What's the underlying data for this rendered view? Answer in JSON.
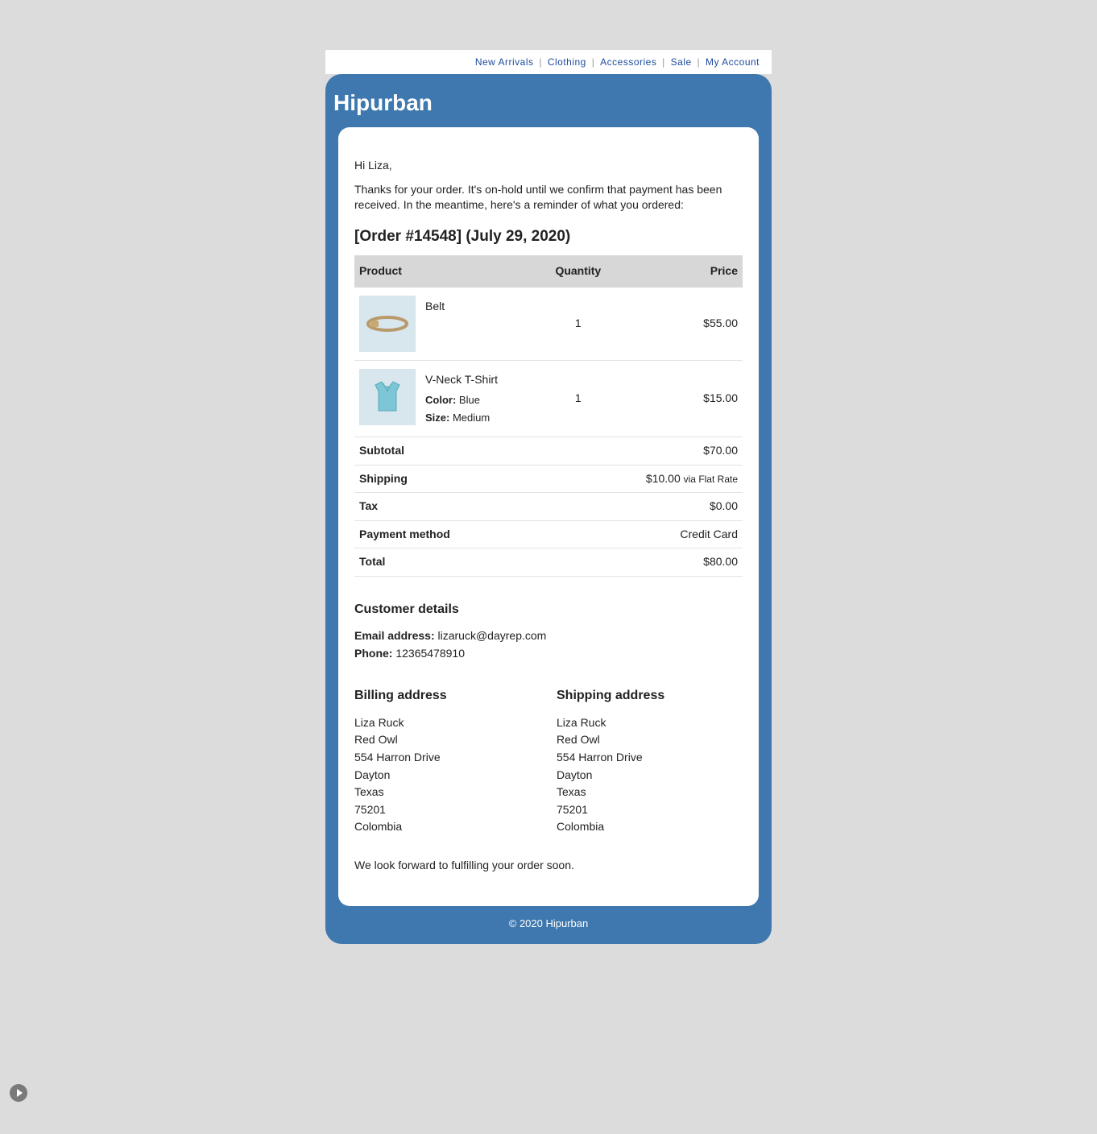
{
  "nav": [
    "New Arrivals",
    "Clothing",
    "Accessories",
    "Sale",
    "My Account"
  ],
  "brand": "Hipurban",
  "greeting": "Hi Liza,",
  "intro": "Thanks for your order. It's on-hold until we confirm that payment has been received. In the meantime, here's a reminder of what you ordered:",
  "order_title": "[Order #14548] (July 29, 2020)",
  "headers": {
    "product": "Product",
    "quantity": "Quantity",
    "price": "Price"
  },
  "items": [
    {
      "name": "Belt",
      "qty": "1",
      "price": "$55.00",
      "attrs": []
    },
    {
      "name": "V-Neck T-Shirt",
      "qty": "1",
      "price": "$15.00",
      "attrs": [
        {
          "label": "Color:",
          "value": "Blue"
        },
        {
          "label": "Size:",
          "value": "Medium"
        }
      ]
    }
  ],
  "summary": {
    "subtotal_label": "Subtotal",
    "subtotal": "$70.00",
    "shipping_label": "Shipping",
    "shipping": "$10.00",
    "shipping_via": "via Flat Rate",
    "tax_label": "Tax",
    "tax": "$0.00",
    "payment_label": "Payment method",
    "payment": "Credit Card",
    "total_label": "Total",
    "total": "$80.00"
  },
  "cust_header": "Customer details",
  "cust": {
    "email_label": "Email address:",
    "email": "lizaruck@dayrep.com",
    "phone_label": "Phone:",
    "phone": "12365478910"
  },
  "billing_header": "Billing address",
  "shipping_header": "Shipping address",
  "address_lines": [
    "Liza Ruck",
    "Red Owl",
    "554 Harron Drive",
    "Dayton",
    "Texas",
    "75201",
    "Colombia"
  ],
  "closing": "We look forward to fulfilling your order soon.",
  "footer": "© 2020 Hipurban"
}
